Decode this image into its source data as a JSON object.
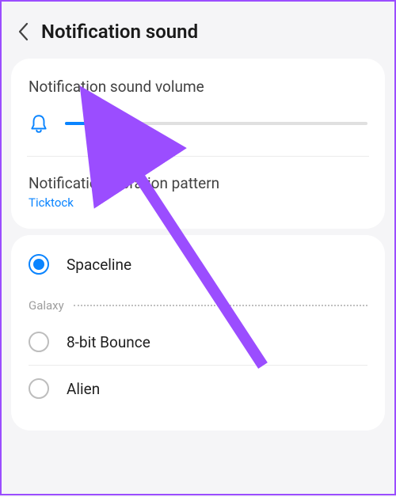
{
  "header": {
    "title": "Notification sound"
  },
  "volume": {
    "label": "Notification sound volume",
    "percent": 16
  },
  "vibration": {
    "label": "Notification vibration pattern",
    "value": "Ticktock"
  },
  "sounds": {
    "selected": "Spaceline",
    "group_label": "Galaxy",
    "items": [
      "8-bit Bounce",
      "Alien"
    ]
  },
  "colors": {
    "accent": "#0a84ff",
    "annotation": "#9b4dff"
  }
}
